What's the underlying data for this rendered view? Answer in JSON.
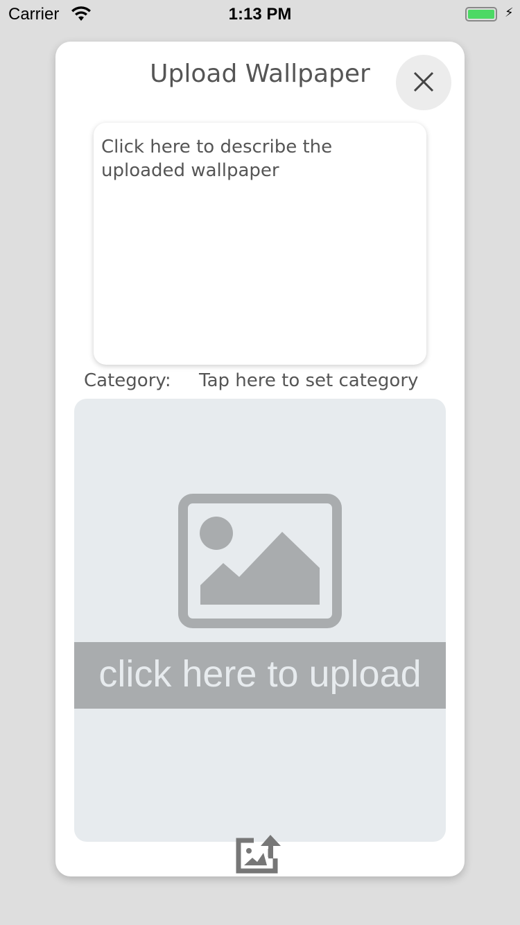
{
  "status_bar": {
    "carrier": "Carrier",
    "time": "1:13 PM",
    "battery_level": 1.0,
    "battery_color": "#4cd964"
  },
  "dialog": {
    "title": "Upload Wallpaper",
    "close_icon": "close-icon",
    "description_placeholder": "Click here to describe the uploaded wallpaper",
    "category_label": "Category:",
    "category_value": "Tap here to set category",
    "upload_text": "click here to upload",
    "upload_icon": "image-upload-icon"
  }
}
